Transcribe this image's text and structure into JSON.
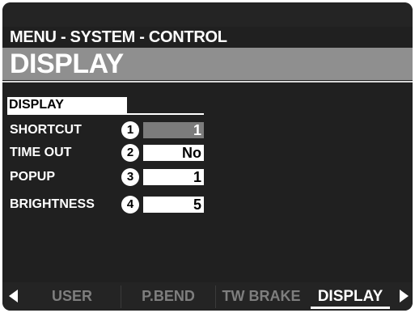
{
  "header": {
    "menu_path": "MENU - SYSTEM - CONTROL",
    "title": "DISPLAY"
  },
  "section": {
    "label": "DISPLAY"
  },
  "params": [
    {
      "number": "1",
      "label": "SHORTCUT",
      "value": "1",
      "selected": true
    },
    {
      "number": "2",
      "label": "TIME OUT",
      "value": "No",
      "selected": false
    },
    {
      "number": "3",
      "label": "POPUP",
      "value": "1",
      "selected": false
    },
    {
      "number": "4",
      "label": "BRIGHTNESS",
      "value": "5",
      "selected": false
    }
  ],
  "tabs": [
    {
      "label": "USER",
      "active": false
    },
    {
      "label": "P.BEND",
      "active": false
    },
    {
      "label": "TW BRAKE",
      "active": false
    },
    {
      "label": "DISPLAY",
      "active": true
    }
  ],
  "colors": {
    "screen_bg": "#202020",
    "title_bar": "#8f8f8f",
    "selected_value_bg": "#7c7c7c",
    "inactive_tab_text": "#7e7e7e"
  },
  "icons": {
    "prev": "left-triangle-arrow-icon",
    "next": "right-triangle-arrow-icon"
  }
}
